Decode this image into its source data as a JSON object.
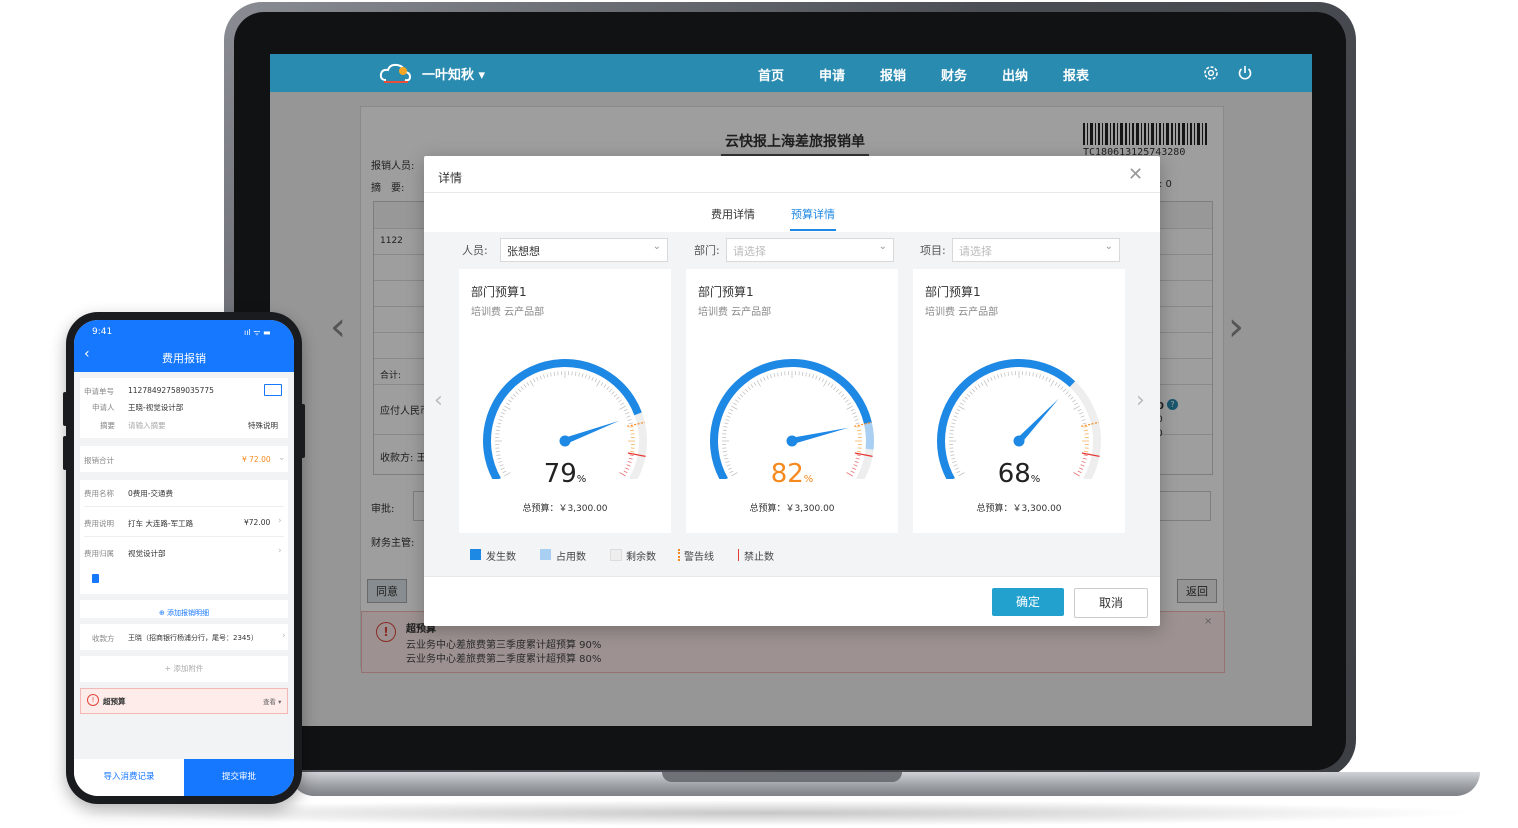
{
  "app": {
    "brand": "一叶知秋",
    "nav": [
      "首页",
      "申请",
      "报销",
      "财务",
      "出纳",
      "报表"
    ]
  },
  "form": {
    "title": "云快报上海差旅报销单",
    "barcode_text": "TC180613125743280",
    "labels": {
      "applicant": "报销人员:",
      "summary": "摘　要:",
      "count_right": ": 0",
      "row_code": "1122",
      "total": "合计:",
      "payable": "应付人民币",
      "payee": "收款方: 王",
      "approve": "审批:",
      "finance_head": "财务主管:",
      "side_value_1": "0",
      "side_value_2": "0",
      "side_value_3": "0"
    },
    "buttons": {
      "agree": "同意",
      "back": "返回"
    },
    "alert": {
      "title": "超预算",
      "lines": [
        "云业务中心差旅费第三季度累计超预算 90%",
        "云业务中心差旅费第二季度累计超预算 80%"
      ]
    }
  },
  "modal": {
    "title": "详情",
    "tabs": [
      {
        "label": "费用详情",
        "active": false
      },
      {
        "label": "预算详情",
        "active": true
      }
    ],
    "filters": [
      {
        "label": "人员:",
        "value": "张想想",
        "placeholder": false
      },
      {
        "label": "部门:",
        "value": "请选择",
        "placeholder": true
      },
      {
        "label": "项目:",
        "value": "请选择",
        "placeholder": true
      }
    ],
    "cards": [
      {
        "title": "部门预算1",
        "subtitle": "培训费 云产品部",
        "percent": "79",
        "percent_unit": "%",
        "percent_color": "#222222",
        "occupied": 0,
        "total": "总预算：￥3,300.00"
      },
      {
        "title": "部门预算1",
        "subtitle": "培训费 云产品部",
        "percent": "82",
        "percent_unit": "%",
        "percent_color": "#f5891f",
        "occupied": 8,
        "total": "总预算：￥3,300.00"
      },
      {
        "title": "部门预算1",
        "subtitle": "培训费 云产品部",
        "percent": "68",
        "percent_unit": "%",
        "percent_color": "#222222",
        "occupied": 0,
        "total": "总预算：￥3,300.00"
      }
    ],
    "legend": [
      "发生数",
      "占用数",
      "剩余数",
      "警告线",
      "禁止数"
    ],
    "buttons": {
      "ok": "确定",
      "cancel": "取消"
    }
  },
  "phone": {
    "time": "9:41",
    "status": "ııl ᯤ ▬",
    "title": "费用报销",
    "apply": {
      "no_label": "申请单号",
      "no_value": "1127849275890357​75",
      "person_label": "申请人",
      "person_value": "王晓-视觉设计部",
      "summary_label": "摘要",
      "summary_placeholder": "请输入摘要",
      "special": "特殊说明"
    },
    "total_label": "报销合计",
    "total_value": "¥ 72.00",
    "expense": {
      "name_label": "费用名称",
      "name_value": "0费用-交通费",
      "desc_label": "费用说明",
      "desc_value": "打车 大连路-军工路",
      "desc_amount": "¥72.00",
      "belong_label": "费用归属",
      "belong_value": "视觉设计部"
    },
    "add_detail": "⊕ 添加报销明细",
    "payee_label": "收款方",
    "payee_value": "王晓（招商银行杨浦分行，尾号：2345）",
    "add_attachment": "+ 添加附件",
    "over_budget": "超预算",
    "view": "查看 ▾",
    "import": "导入消费记录",
    "submit": "提交审批"
  }
}
